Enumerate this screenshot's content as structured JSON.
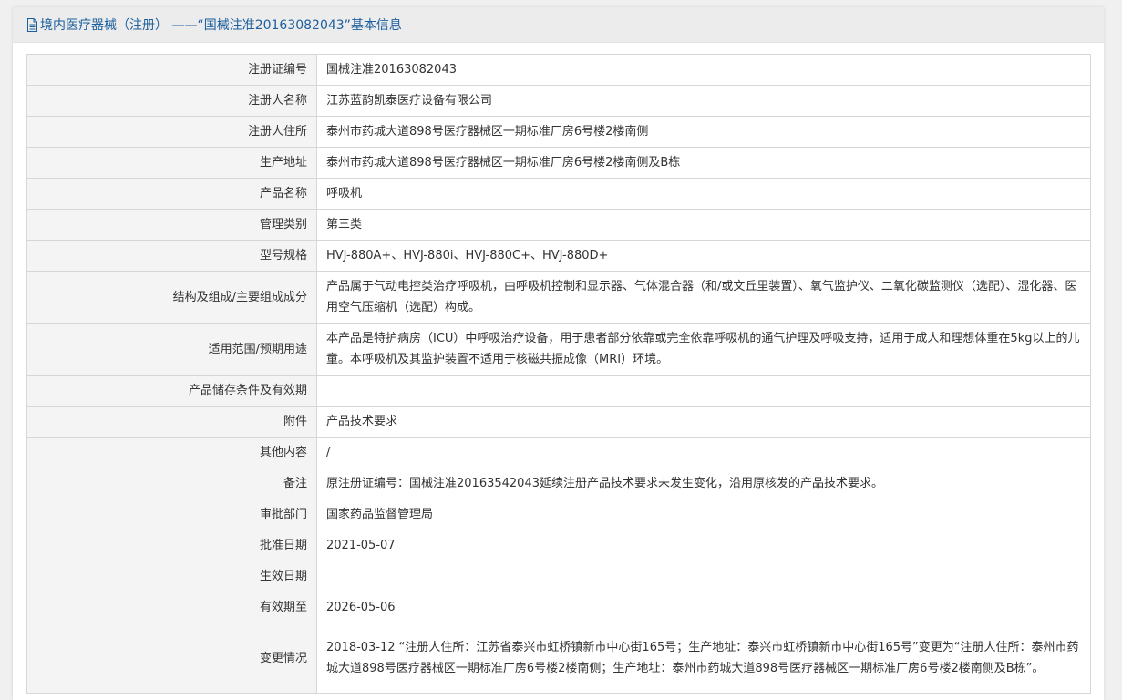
{
  "header": {
    "icon": "document-icon",
    "title": "境内医疗器械（注册） ——“国械注准20163082043”基本信息",
    "accent": "#1c5f9e"
  },
  "rows": [
    {
      "label": "注册证编号",
      "value": "国械注准20163082043"
    },
    {
      "label": "注册人名称",
      "value": "江苏蓝韵凯泰医疗设备有限公司"
    },
    {
      "label": "注册人住所",
      "value": "泰州市药城大道898号医疗器械区一期标准厂房6号楼2楼南侧"
    },
    {
      "label": "生产地址",
      "value": "泰州市药城大道898号医疗器械区一期标准厂房6号楼2楼南侧及B栋"
    },
    {
      "label": "产品名称",
      "value": "呼吸机"
    },
    {
      "label": "管理类别",
      "value": "第三类"
    },
    {
      "label": "型号规格",
      "value": "HVJ-880A+、HVJ-880i、HVJ-880C+、HVJ-880D+"
    },
    {
      "label": "结构及组成/主要组成成分",
      "value": "产品属于气动电控类治疗呼吸机，由呼吸机控制和显示器、气体混合器（和/或文丘里装置）、氧气监护仪、二氧化碳监测仪（选配）、湿化器、医用空气压缩机（选配）构成。"
    },
    {
      "label": "适用范围/预期用途",
      "value": "本产品是特护病房（ICU）中呼吸治疗设备，用于患者部分依靠或完全依靠呼吸机的通气护理及呼吸支持，适用于成人和理想体重在5kg以上的儿童。本呼吸机及其监护装置不适用于核磁共振成像（MRI）环境。"
    },
    {
      "label": "产品储存条件及有效期",
      "value": ""
    },
    {
      "label": "附件",
      "value": "产品技术要求"
    },
    {
      "label": "其他内容",
      "value": "/"
    },
    {
      "label": "备注",
      "value": "原注册证编号：国械注准20163542043延续注册产品技术要求未发生变化，沿用原核发的产品技术要求。"
    },
    {
      "label": "审批部门",
      "value": "国家药品监督管理局"
    },
    {
      "label": "批准日期",
      "value": "2021-05-07"
    },
    {
      "label": "生效日期",
      "value": ""
    },
    {
      "label": "有效期至",
      "value": "2026-05-06"
    },
    {
      "label": "变更情况",
      "value": "2018-03-12 “注册人住所：江苏省泰兴市虹桥镇新市中心街165号；生产地址：泰兴市虹桥镇新市中心街165号”变更为“注册人住所：泰州市药城大道898号医疗器械区一期标准厂房6号楼2楼南侧；生产地址：泰州市药城大道898号医疗器械区一期标准厂房6号楼2楼南侧及B栋”。"
    }
  ]
}
